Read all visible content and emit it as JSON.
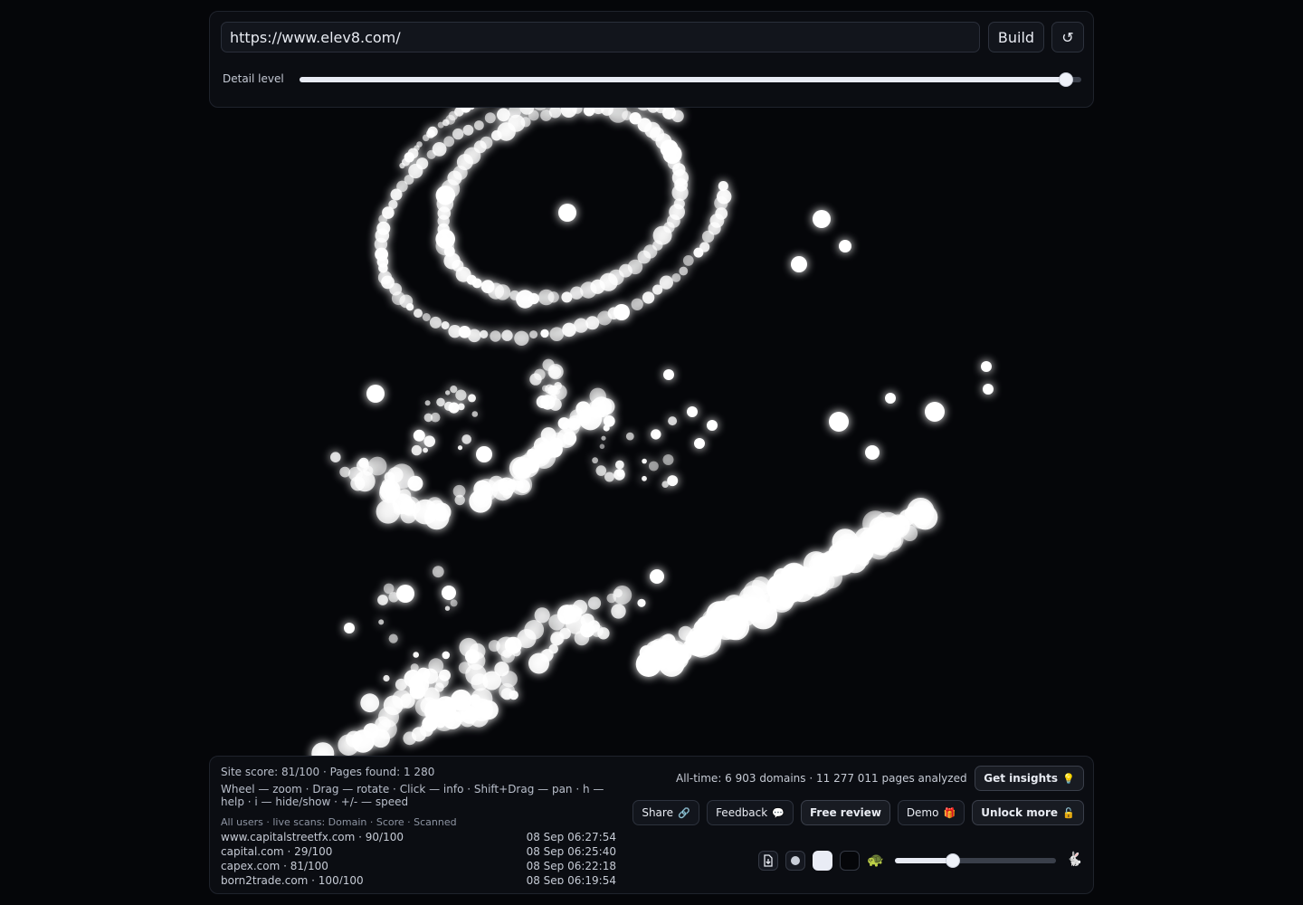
{
  "header": {
    "url_value": "https://www.elev8.com/",
    "build_label": "Build",
    "reset_glyph": "↺",
    "detail_label": "Detail level",
    "detail_value_percent": 98
  },
  "stats": {
    "site_score_line": "Site score: 81/100 · Pages found: 1 280",
    "help_line": "Wheel — zoom · Drag — rotate · Click — info · Shift+Drag — pan · h — help · i — hide/show · +/- — speed",
    "feed_header": "All users · live scans: Domain · Score · Scanned",
    "feed": [
      {
        "domain": "www.capitalstreetfx.com · 90/100",
        "time": "08 Sep 06:27:54"
      },
      {
        "domain": "capital.com · 29/100",
        "time": "08 Sep 06:25:40"
      },
      {
        "domain": "capex.com · 81/100",
        "time": "08 Sep 06:22:18"
      },
      {
        "domain": "born2trade.com · 100/100",
        "time": "08 Sep 06:19:54"
      }
    ],
    "alltime_line": "All-time: 6 903 domains · 11 277 011 pages analyzed"
  },
  "actions": {
    "insights_label": "Get insights",
    "insights_icon": "💡",
    "share_label": "Share",
    "share_icon": "🔗",
    "feedback_label": "Feedback",
    "feedback_icon": "💬",
    "review_label": "Free review",
    "demo_label": "Demo",
    "demo_icon": "🎁",
    "unlock_label": "Unlock more",
    "unlock_icon": "🔓"
  },
  "controls": {
    "export_icon": "download-icon",
    "point_icon": "dot-icon",
    "light_theme": "light-theme-swatch",
    "dark_theme": "dark-theme-swatch",
    "turtle_glyph": "🐢",
    "rabbit_glyph": "🐇",
    "speed_value_percent": 36
  },
  "colors": {
    "background": "#050609",
    "panel": "#0b0d12",
    "particle": "#ffffff"
  }
}
